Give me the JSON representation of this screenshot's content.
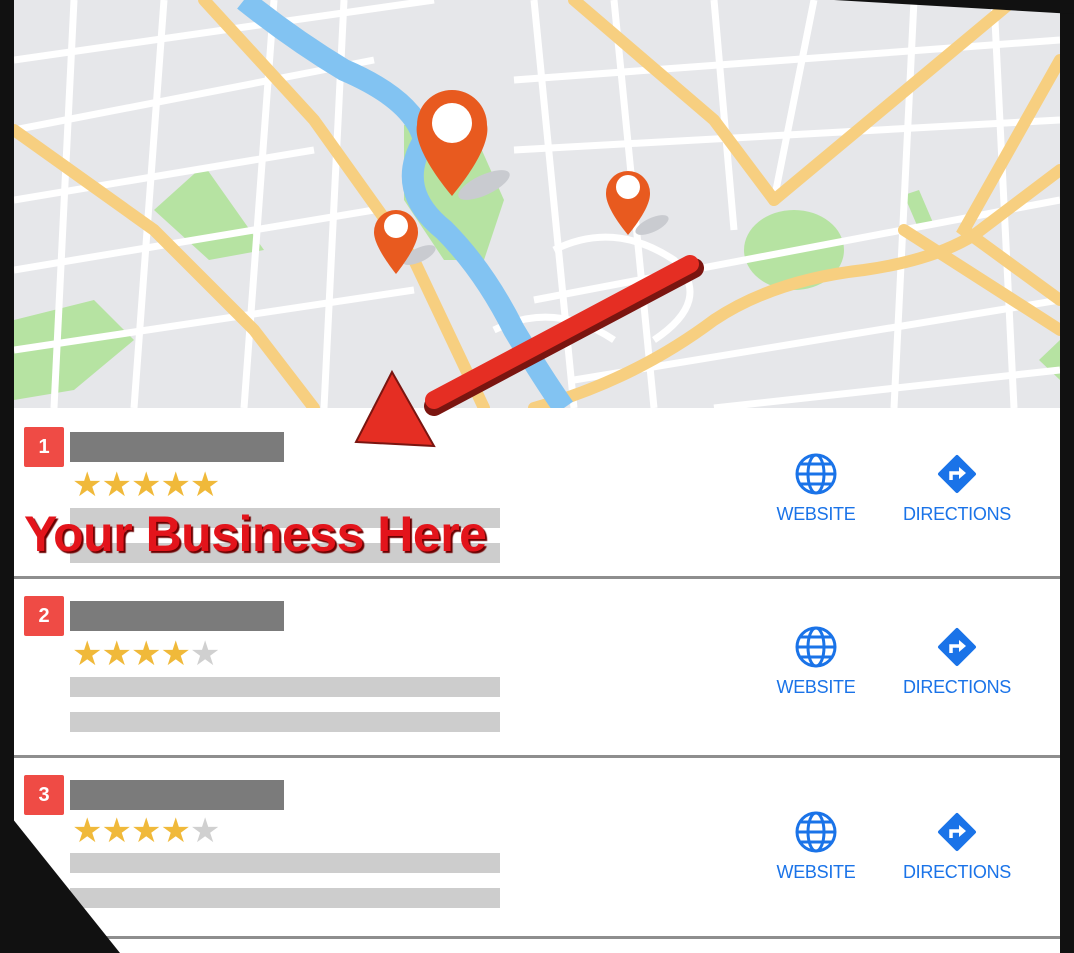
{
  "map": {
    "pins": [
      {
        "name": "main-pin"
      },
      {
        "name": "left-pin"
      },
      {
        "name": "right-pin"
      }
    ],
    "arrow_color": "#e52e23"
  },
  "listings": [
    {
      "rank": "1",
      "rating": 5,
      "max_rating": 5,
      "stars_on": "★★★★★",
      "stars_off": "",
      "website_label": "WEBSITE",
      "directions_label": "DIRECTIONS",
      "promo_text": "Your Business Here"
    },
    {
      "rank": "2",
      "rating": 4,
      "max_rating": 5,
      "stars_on": "★★★★",
      "stars_off": "★",
      "website_label": "WEBSITE",
      "directions_label": "DIRECTIONS"
    },
    {
      "rank": "3",
      "rating": 4,
      "max_rating": 5,
      "stars_on": "★★★★",
      "stars_off": "★",
      "website_label": "WEBSITE",
      "directions_label": "DIRECTIONS"
    }
  ],
  "colors": {
    "accent": "#1a73e8",
    "rank_badge": "#ef4b45",
    "star": "#f0b93a",
    "promo": "#e3141b",
    "pin": "#e85a1f"
  }
}
